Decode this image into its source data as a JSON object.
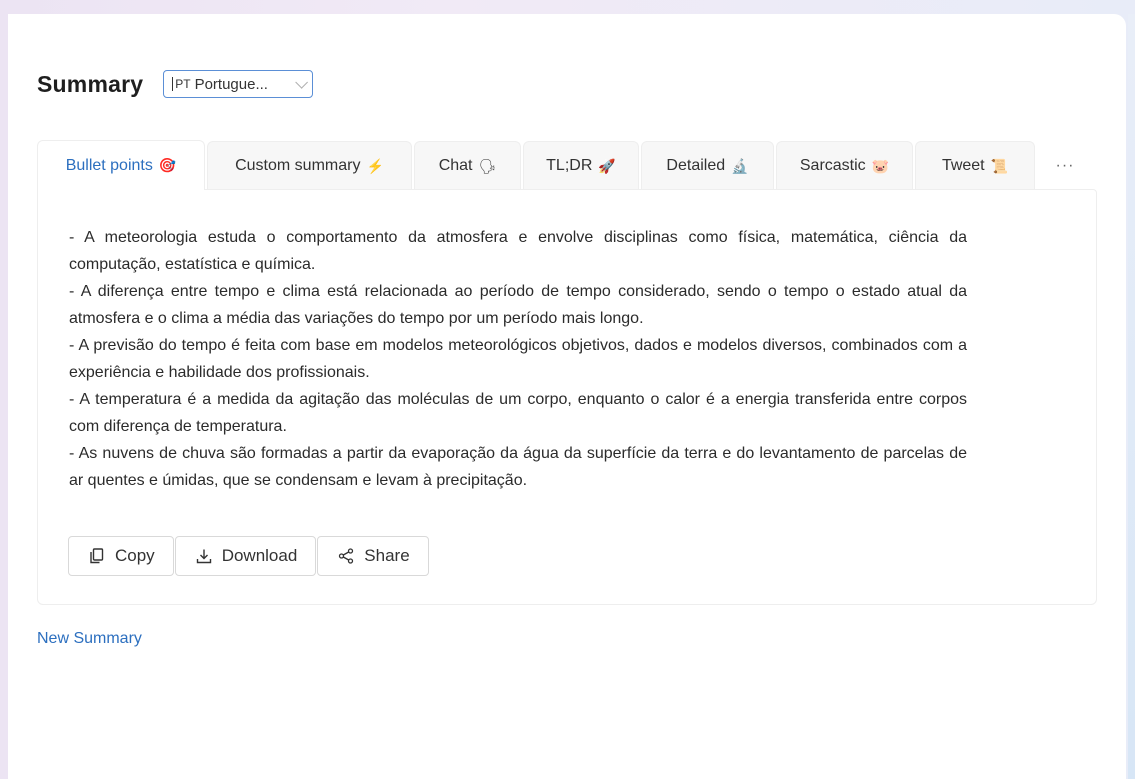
{
  "header": {
    "title": "Summary",
    "language": {
      "code": "PT",
      "label": "Portugue..."
    }
  },
  "tabs": [
    {
      "label": "Bullet points",
      "emoji": "🎯",
      "active": true
    },
    {
      "label": "Custom summary",
      "emoji": "⚡"
    },
    {
      "label": "Chat",
      "emoji": "🗣"
    },
    {
      "label": "TL;DR",
      "emoji": "🚀"
    },
    {
      "label": "Detailed",
      "emoji": "🔬"
    },
    {
      "label": "Sarcastic",
      "emoji": "🐷"
    },
    {
      "label": "Tweet",
      "emoji": "📜"
    }
  ],
  "more_tabs": "···",
  "summary": {
    "lines": [
      "- A meteorologia estuda o comportamento da atmosfera e envolve disciplinas como física, matemática, ciência da computação, estatística e química.",
      "- A diferença entre tempo e clima está relacionada ao período de tempo considerado, sendo o tempo o estado atual da atmosfera e o clima a média das variações do tempo por um período mais longo.",
      "- A previsão do tempo é feita com base em modelos meteorológicos objetivos, dados e modelos diversos, combinados com a experiência e habilidade dos profissionais.",
      "- A temperatura é a medida da agitação das moléculas de um corpo, enquanto o calor é a energia transferida entre corpos com diferença de temperatura.",
      "- As nuvens de chuva são formadas a partir da evaporação da água da superfície da terra e do levantamento de parcelas de ar quentes e úmidas, que se condensam e levam à precipitação."
    ]
  },
  "actions": {
    "copy": "Copy",
    "download": "Download",
    "share": "Share"
  },
  "new_summary": "New Summary",
  "colors": {
    "accent": "#2c6fbf",
    "select_border": "#5b8fd6",
    "text": "#2b2b2b"
  }
}
